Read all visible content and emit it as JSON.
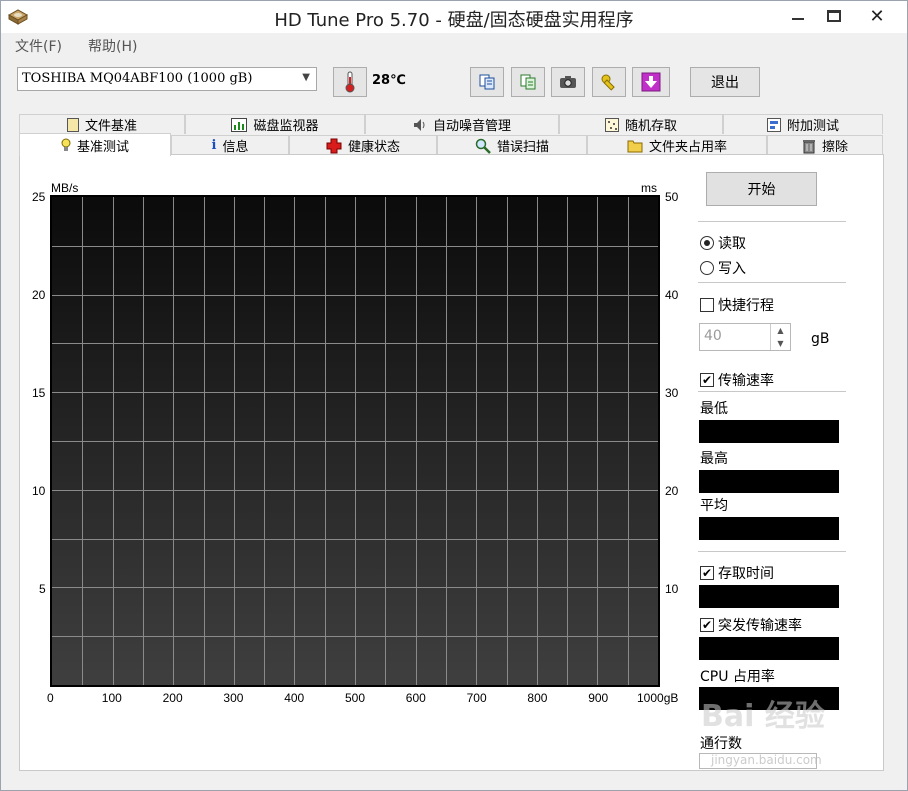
{
  "window": {
    "title": "HD Tune Pro 5.70 - 硬盘/固态硬盘实用程序",
    "close_glyph": "✕"
  },
  "menu": {
    "items": [
      "文件(F)",
      "帮助(H)"
    ]
  },
  "toolbar": {
    "drive": "TOSHIBA MQ04ABF100 (1000 gB)",
    "temperature": "28℃",
    "exit_label": "退出"
  },
  "tabs": {
    "top_row": [
      "文件基准",
      "磁盘监视器",
      "自动噪音管理",
      "随机存取",
      "附加测试"
    ],
    "bottom_row": [
      "基准测试",
      "信息",
      "健康状态",
      "错误扫描",
      "文件夹占用率",
      "擦除"
    ],
    "active": "基准测试"
  },
  "chart": {
    "y_left_unit": "MB/s",
    "y_right_unit": "ms",
    "y_left_ticks": [
      "25",
      "20",
      "15",
      "10",
      "5"
    ],
    "y_right_ticks": [
      "50",
      "40",
      "30",
      "20",
      "10"
    ],
    "x_ticks": [
      "0",
      "100",
      "200",
      "300",
      "400",
      "500",
      "600",
      "700",
      "800",
      "900",
      "1000gB"
    ]
  },
  "chart_data": {
    "type": "line",
    "xlabel": "",
    "ylabel": "MB/s",
    "y2label": "ms",
    "xlim": [
      0,
      1000
    ],
    "ylim": [
      0,
      25
    ],
    "y2lim": [
      0,
      50
    ],
    "grid": true,
    "series": []
  },
  "controls": {
    "start_label": "开始",
    "mode_read": "读取",
    "mode_write": "写入",
    "short_stroke": "快捷行程",
    "stroke_value": "40",
    "stroke_unit": "gB",
    "transfer_rate": "传输速率",
    "min_label": "最低",
    "max_label": "最高",
    "avg_label": "平均",
    "access_time": "存取时间",
    "burst_rate": "突发传输速率",
    "cpu_usage": "CPU 占用率",
    "passes": "通行数"
  },
  "overlay": {
    "watermark": "Bai 经验",
    "watermark_url": "jingyan.baidu.com"
  }
}
